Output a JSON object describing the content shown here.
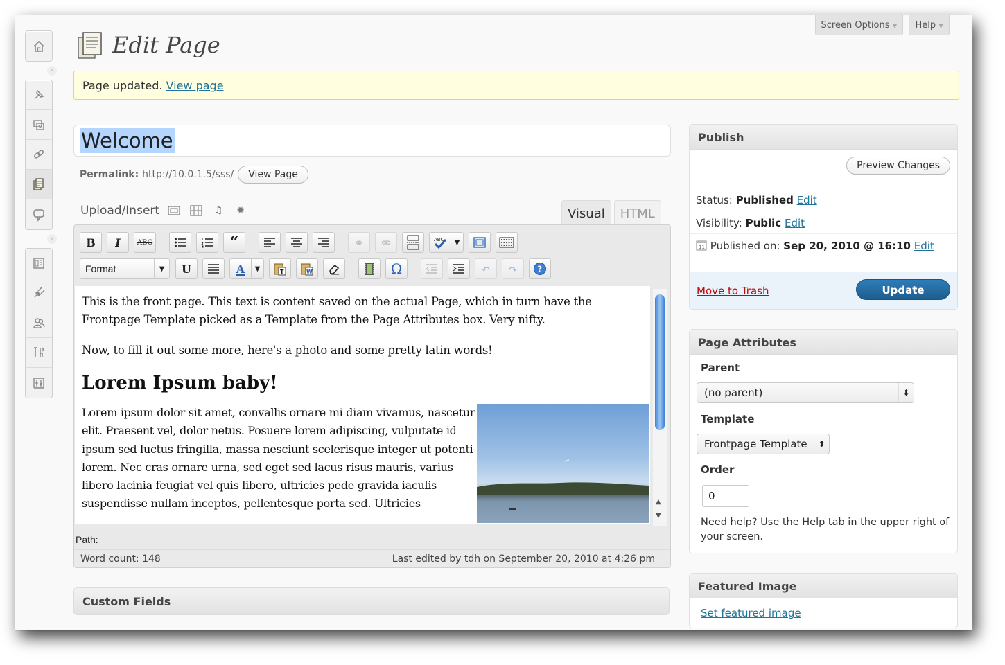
{
  "header": {
    "title": "Edit Page",
    "screen_options": "Screen Options",
    "help": "Help"
  },
  "notice": {
    "text": "Page updated.",
    "link": "View page"
  },
  "post": {
    "title": "Welcome",
    "permalink_label": "Permalink:",
    "permalink_url": "http://10.0.1.5/sss/",
    "view_page_button": "View Page"
  },
  "editor": {
    "upload_insert": "Upload/Insert",
    "tab_visual": "Visual",
    "tab_html": "HTML",
    "format_select": "Format",
    "paragraph1": "This is the front page. This text is content saved on the actual Page, which in turn have the Frontpage Template picked as a Template from the Page Attributes box. Very nifty.",
    "paragraph2": "Now, to fill it out some more, here's a photo and some pretty latin words!",
    "heading": "Lorem Ipsum baby!",
    "paragraph3": "Lorem ipsum dolor sit amet, convallis ornare mi diam vivamus, nascetur elit. Praesent vel, dolor netus. Posuere lorem adipiscing, vulputate id ipsum sed luctus fringilla, massa nesciunt scelerisque integer ut potenti lorem. Nec cras ornare urna, sed eget sed lacus risus mauris, varius libero lacinia feugiat vel quis libero, ultricies pede gravida iaculis suspendisse nullam inceptos, pellentesque porta sed. Ultricies",
    "path_label": "Path:",
    "word_count": "Word count: 148",
    "last_edited": "Last edited by tdh on September 20, 2010 at 4:26 pm",
    "toolbar": {
      "bold": "B",
      "italic": "I",
      "strike": "ABC",
      "underline": "U",
      "text_color": "A",
      "omega": "Ω"
    }
  },
  "custom_fields": {
    "title": "Custom Fields"
  },
  "publish": {
    "title": "Publish",
    "preview_button": "Preview Changes",
    "status_label": "Status:",
    "status_value": "Published",
    "visibility_label": "Visibility:",
    "visibility_value": "Public",
    "published_label": "Published on:",
    "published_value": "Sep 20, 2010 @ 16:10",
    "edit": "Edit",
    "trash": "Move to Trash",
    "update": "Update"
  },
  "attributes": {
    "title": "Page Attributes",
    "parent_label": "Parent",
    "parent_value": "(no parent)",
    "template_label": "Template",
    "template_value": "Frontpage Template",
    "order_label": "Order",
    "order_value": "0",
    "help": "Need help? Use the Help tab in the upper right of your screen."
  },
  "featured": {
    "title": "Featured Image",
    "link": "Set featured image"
  },
  "colors": {
    "link": "#21759b",
    "notice_bg": "#ffffe0",
    "notice_border": "#e6db55",
    "update_button": "#21759b",
    "trash": "#bc0b0b"
  },
  "icons": {
    "admin_menu": [
      "dashboard-icon",
      "posts-icon",
      "media-icon",
      "links-icon",
      "pages-icon",
      "comments-icon",
      "appearance-icon",
      "plugins-icon",
      "users-icon",
      "tools-icon",
      "settings-icon"
    ]
  }
}
